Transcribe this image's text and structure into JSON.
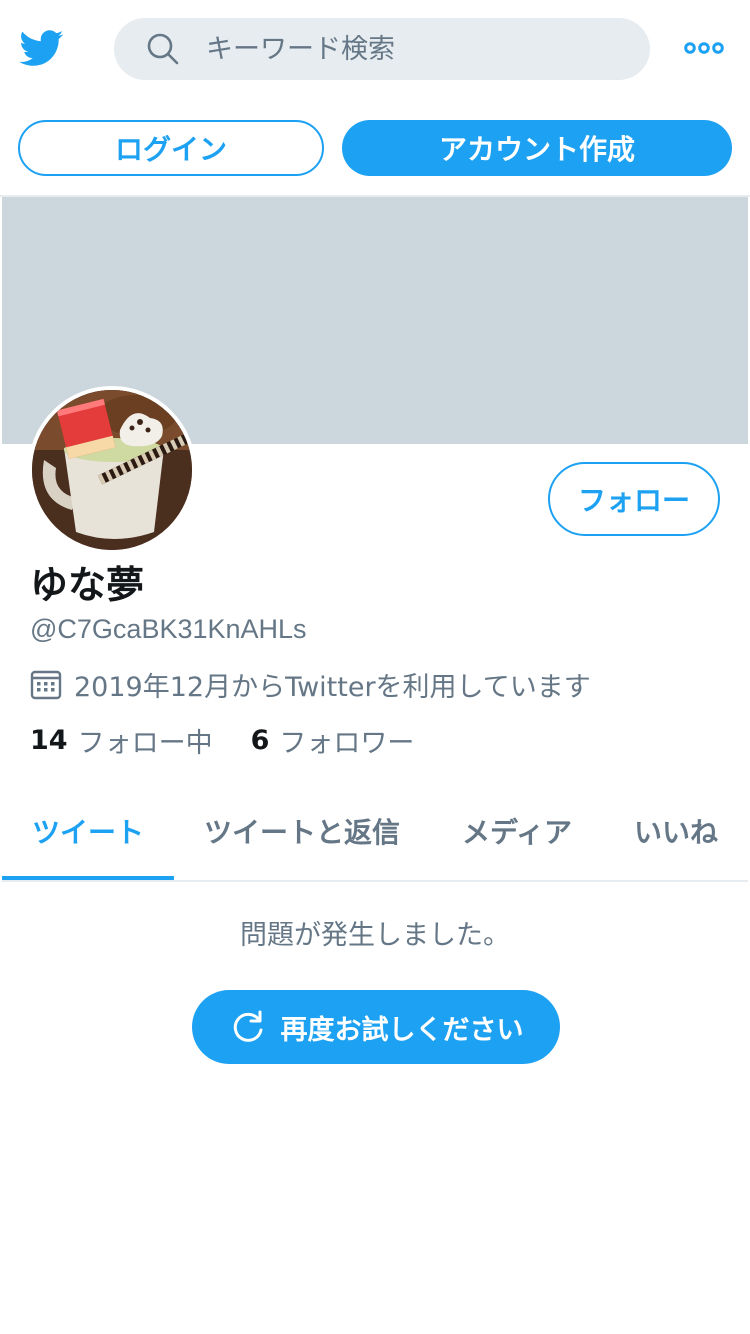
{
  "header": {
    "logo_icon": "twitter-bird-icon",
    "search": {
      "placeholder": "キーワード検索",
      "icon": "search-icon"
    },
    "more_icon": "more-dots-icon"
  },
  "auth": {
    "login_label": "ログイン",
    "signup_label": "アカウント作成"
  },
  "profile": {
    "display_name": "ゆな夢",
    "handle": "@C7GcaBK31KnAHLs",
    "joined": "2019年12月からTwitterを利用しています",
    "follow_label": "フォロー",
    "stats": {
      "following_count": "14",
      "following_label": "フォロー中",
      "followers_count": "6",
      "followers_label": "フォロワー"
    }
  },
  "tabs": [
    {
      "label": "ツイート",
      "active": true
    },
    {
      "label": "ツイートと返信",
      "active": false
    },
    {
      "label": "メディア",
      "active": false
    },
    {
      "label": "いいね",
      "active": false
    }
  ],
  "error": {
    "message": "問題が発生しました。",
    "retry_label": "再度お試しください"
  },
  "colors": {
    "accent": "#1da1f2",
    "banner": "#ccd6dd",
    "text_primary": "#14171a",
    "text_secondary": "#657786"
  }
}
